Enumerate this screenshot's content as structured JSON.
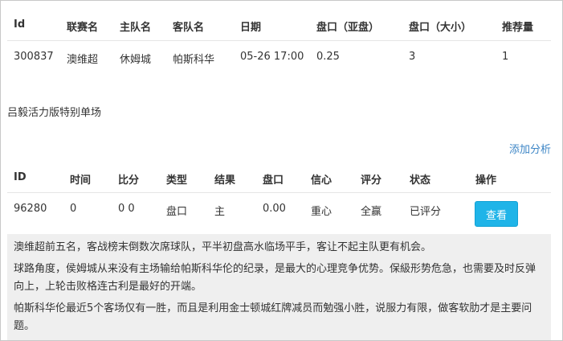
{
  "match_table": {
    "headers": [
      "Id",
      "联赛名",
      "主队名",
      "客队名",
      "日期",
      "盘口（亚盘）",
      "盘口（大小）",
      "推荐量"
    ],
    "row": [
      "300837",
      "澳维超",
      "休姆城",
      "帕斯科华",
      "05-26 17:00",
      "0.25",
      "3",
      "1"
    ]
  },
  "section_label": "吕毅活力版特别单场",
  "add_analysis_link": "添加分析",
  "pick_table": {
    "headers": [
      "ID",
      "时间",
      "比分",
      "类型",
      "结果",
      "盘口",
      "信心",
      "评分",
      "状态",
      "操作"
    ],
    "row": [
      "96280",
      "0",
      "0 0",
      "盘口",
      "主",
      "0.00",
      "重心",
      "全赢",
      "已评分"
    ],
    "action_label": "查看"
  },
  "analysis_paragraphs": [
    "澳维超前五名，客战榜末倒数次席球队，平半初盘高水临场平手，客让不起主队更有机会。",
    "球路角度，侯姆城从来没有主场输给帕斯科华伦的纪录，是最大的心理竞争优势。保級形势危急，也需要及时反弹向上，上轮击败格连古利是最好的开端。",
    "帕斯科华伦最近5个客场仅有一胜，而且是利用金士顿城红牌减员而勉强小胜，说服力有限，做客软肋才是主要问题。"
  ],
  "colors": {
    "accent_link": "#3d86c6",
    "button_bg": "#1fb4e8",
    "analysis_bg": "#efefef"
  }
}
